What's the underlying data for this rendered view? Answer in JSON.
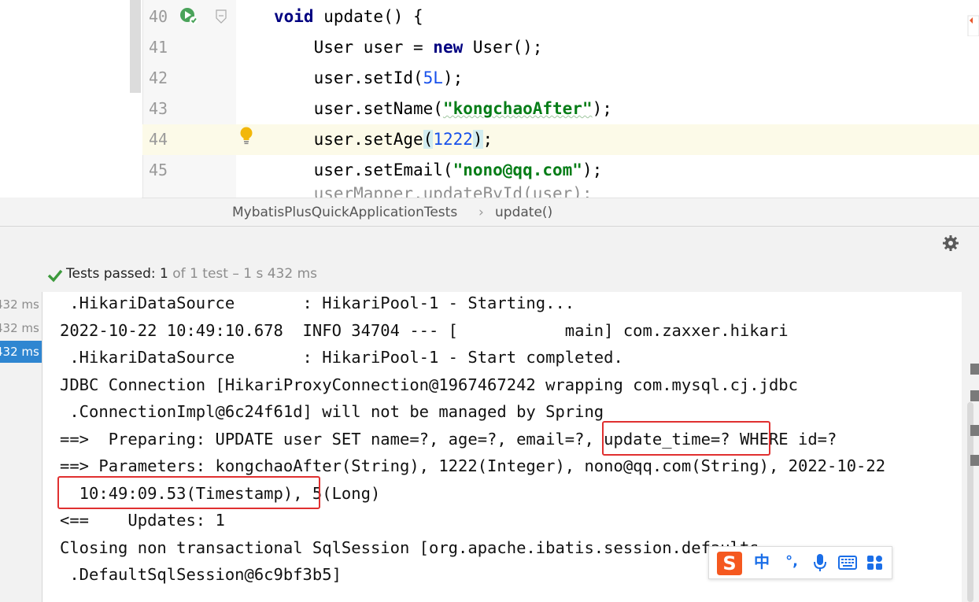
{
  "editor": {
    "lines": [
      {
        "num": "40",
        "parts": [
          {
            "t": "void",
            "c": "kw"
          },
          {
            "t": " update() {"
          }
        ]
      },
      {
        "num": "41",
        "parts": [
          {
            "t": "    User user = "
          },
          {
            "t": "new",
            "c": "kw"
          },
          {
            "t": " User();"
          }
        ]
      },
      {
        "num": "42",
        "parts": [
          {
            "t": "    user.setId("
          },
          {
            "t": "5L",
            "c": "num"
          },
          {
            "t": ");"
          }
        ]
      },
      {
        "num": "43",
        "parts": [
          {
            "t": "    user.setName("
          },
          {
            "t": "\"kongchaoAfter\"",
            "c": "str squiggle"
          },
          {
            "t": ");"
          }
        ]
      },
      {
        "num": "44",
        "parts": [
          {
            "t": "    user.setAge"
          },
          {
            "t": "(",
            "c": "bracket-hl"
          },
          {
            "t": "1222",
            "c": "num"
          },
          {
            "t": ")",
            "c": "bracket-hl"
          },
          {
            "t": ";"
          }
        ]
      },
      {
        "num": "45",
        "parts": [
          {
            "t": "    user.setEmail("
          },
          {
            "t": "\"nono@qq.com\"",
            "c": "str"
          },
          {
            "t": ");"
          }
        ]
      }
    ],
    "partial_line": "    userMapper.updateById(user);"
  },
  "breadcrumb": {
    "class_name": "MybatisPlusQuickApplicationTests",
    "separator": "›",
    "method_name": "update()"
  },
  "run": {
    "status_passed": "Tests passed:",
    "status_count": "1",
    "status_rest": "of 1 test – 1 s 432 ms",
    "tree": [
      {
        "label": "432 ms",
        "selected": false
      },
      {
        "label": "432 ms",
        "selected": false
      },
      {
        "label": "432 ms",
        "selected": true
      }
    ],
    "console": [
      " .HikariDataSource       : HikariPool-1 - Starting...",
      "2022-10-22 10:49:10.678  INFO 34704 --- [           main] com.zaxxer.hikari",
      " .HikariDataSource       : HikariPool-1 - Start completed.",
      "JDBC Connection [HikariProxyConnection@1967467242 wrapping com.mysql.cj.jdbc",
      " .ConnectionImpl@6c24f61d] will not be managed by Spring",
      "==>  Preparing: UPDATE user SET name=?, age=?, email=?, update_time=? WHERE id=?",
      "==> Parameters: kongchaoAfter(String), 1222(Integer), nono@qq.com(String), 2022-10-22",
      "  10:49:09.53(Timestamp), 5(Long)",
      "<==    Updates: 1",
      "Closing non transactional SqlSession [org.apache.ibatis.session.defaults",
      " .DefaultSqlSession@6c9bf3b5]"
    ]
  },
  "ime": {
    "items": [
      "中",
      "°,",
      "mic-icon",
      "keyboard-icon",
      "grid-icon"
    ],
    "lang_label": "中",
    "punct_label": "°,"
  },
  "colors": {
    "highlight_box": "#e03030",
    "selection": "#2f86d1",
    "pass_green": "#3c9a3c"
  }
}
